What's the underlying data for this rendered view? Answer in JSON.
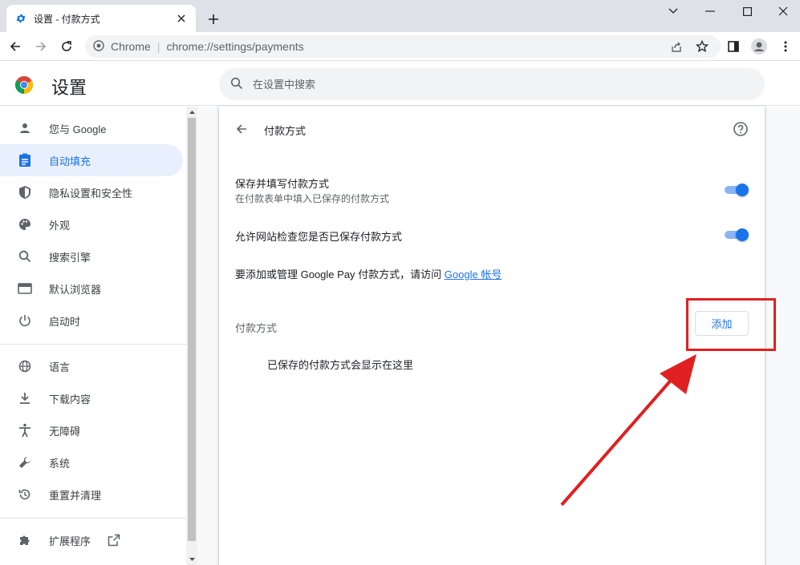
{
  "browser": {
    "tab": {
      "title": "设置 - 付款方式"
    },
    "omnibox": {
      "site_label": "Chrome",
      "url_scheme": "chrome://",
      "url_path": "settings/payments"
    }
  },
  "header": {
    "title": "设置",
    "search_placeholder": "在设置中搜索"
  },
  "sidebar": {
    "items": [
      {
        "label": "您与 Google",
        "icon": "person-icon"
      },
      {
        "label": "自动填充",
        "icon": "clipboard-icon",
        "active": true
      },
      {
        "label": "隐私设置和安全性",
        "icon": "shield-icon"
      },
      {
        "label": "外观",
        "icon": "palette-icon"
      },
      {
        "label": "搜索引擎",
        "icon": "search-icon"
      },
      {
        "label": "默认浏览器",
        "icon": "browser-icon"
      },
      {
        "label": "启动时",
        "icon": "power-icon"
      },
      {
        "label": "语言",
        "icon": "globe-icon"
      },
      {
        "label": "下载内容",
        "icon": "download-icon"
      },
      {
        "label": "无障碍",
        "icon": "accessibility-icon"
      },
      {
        "label": "系统",
        "icon": "wrench-icon"
      },
      {
        "label": "重置并清理",
        "icon": "history-icon"
      },
      {
        "label": "扩展程序",
        "icon": "puzzle-icon"
      }
    ]
  },
  "payments": {
    "section_title": "付款方式",
    "save_fill_label": "保存并填写付款方式",
    "save_fill_sub": "在付款表单中填入已保存的付款方式",
    "save_fill_enabled": true,
    "allow_check_label": "允许网站检查您是否已保存付款方式",
    "allow_check_enabled": true,
    "gpay_text": "要添加或管理 Google Pay 付款方式，请访问 ",
    "gpay_link": "Google 帐号",
    "list_heading": "付款方式",
    "add_button": "添加",
    "empty_message": "已保存的付款方式会显示在这里"
  },
  "colors": {
    "accent": "#1a73e8",
    "annotation": "#e02020"
  }
}
